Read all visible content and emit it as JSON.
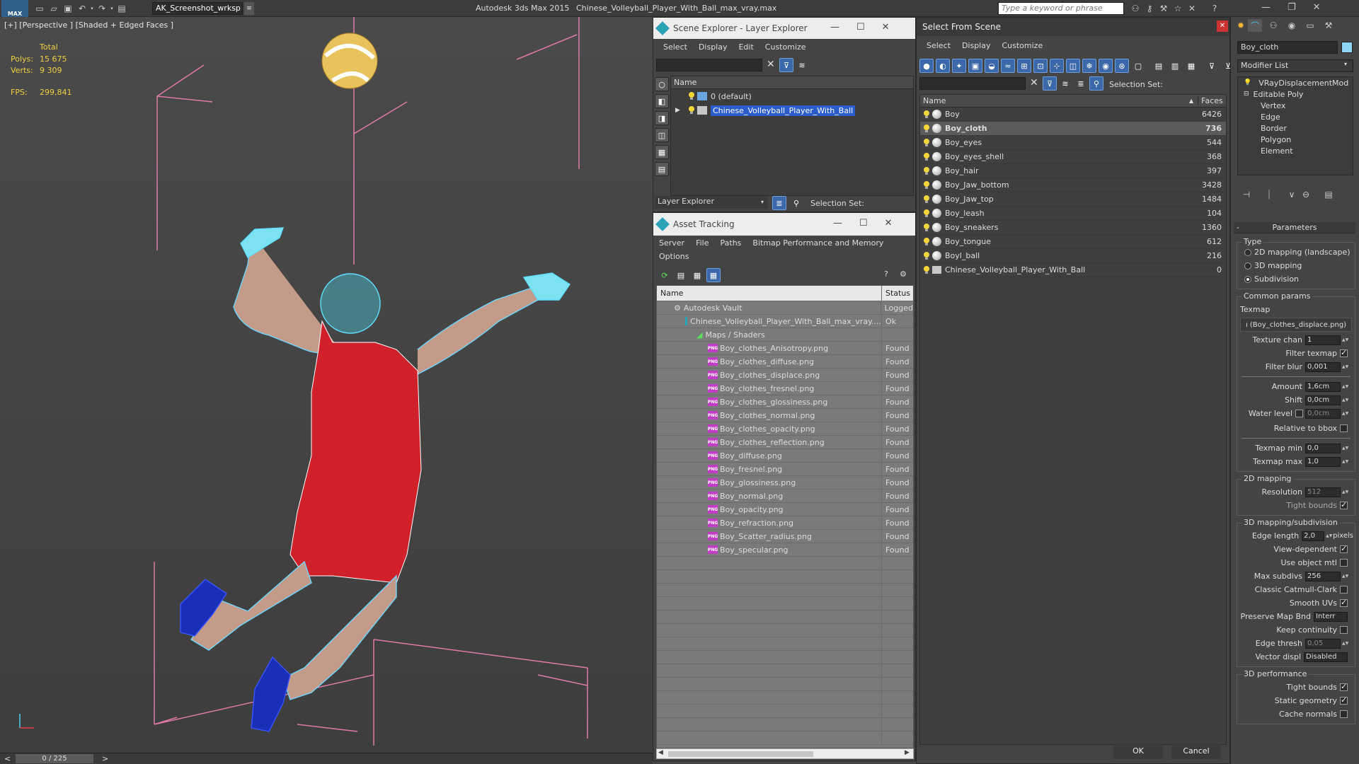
{
  "titlebar": {
    "logo": "MAX",
    "workspace": "AK_Screenshot_wrksp",
    "app": "Autodesk 3ds Max  2015",
    "file": "Chinese_Volleyball_Player_With_Ball_max_vray.max",
    "search_placeholder": "Type a keyword or phrase"
  },
  "viewport": {
    "label": "[+] [Perspective ] [Shaded + Edged Faces ]",
    "stats_header": "Total",
    "polys_label": "Polys:",
    "polys": "15 675",
    "verts_label": "Verts:",
    "verts": "9 309",
    "fps_label": "FPS:",
    "fps": "299,841"
  },
  "timeline": {
    "frame": "0 / 225",
    "prev": "<",
    "next": ">"
  },
  "scene_explorer": {
    "title": "Scene Explorer - Layer Explorer",
    "menu": [
      "Select",
      "Display",
      "Edit",
      "Customize"
    ],
    "col_name": "Name",
    "layers": [
      "0 (default)",
      "Chinese_Volleyball_Player_With_Ball"
    ],
    "footer_mode": "Layer Explorer",
    "selection_set": "Selection Set:"
  },
  "asset_tracking": {
    "title": "Asset Tracking",
    "menu": [
      "Server",
      "File",
      "Paths",
      "Bitmap Performance and Memory"
    ],
    "menu2": "Options",
    "col_name": "Name",
    "col_status": "Status",
    "vault": {
      "name": "Autodesk Vault",
      "status": "Logged"
    },
    "file": {
      "name": "Chinese_Volleyball_Player_With_Ball_max_vray....",
      "status": "Ok"
    },
    "folder": "Maps / Shaders",
    "maps": [
      {
        "name": "Boy_clothes_Anisotropy.png",
        "status": "Found"
      },
      {
        "name": "Boy_clothes_diffuse.png",
        "status": "Found"
      },
      {
        "name": "Boy_clothes_displace.png",
        "status": "Found"
      },
      {
        "name": "Boy_clothes_fresnel.png",
        "status": "Found"
      },
      {
        "name": "Boy_clothes_glossiness.png",
        "status": "Found"
      },
      {
        "name": "Boy_clothes_normal.png",
        "status": "Found"
      },
      {
        "name": "Boy_clothes_opacity.png",
        "status": "Found"
      },
      {
        "name": "Boy_clothes_reflection.png",
        "status": "Found"
      },
      {
        "name": "Boy_diffuse.png",
        "status": "Found"
      },
      {
        "name": "Boy_fresnel.png",
        "status": "Found"
      },
      {
        "name": "Boy_glossiness.png",
        "status": "Found"
      },
      {
        "name": "Boy_normal.png",
        "status": "Found"
      },
      {
        "name": "Boy_opacity.png",
        "status": "Found"
      },
      {
        "name": "Boy_refraction.png",
        "status": "Found"
      },
      {
        "name": "Boy_Scatter_radius.png",
        "status": "Found"
      },
      {
        "name": "Boy_specular.png",
        "status": "Found"
      }
    ],
    "png_tag": "PNG"
  },
  "select_from_scene": {
    "title": "Select From Scene",
    "menu": [
      "Select",
      "Display",
      "Customize"
    ],
    "selection_set": "Selection Set:",
    "col_name": "Name",
    "col_faces": "Faces",
    "objects": [
      {
        "name": "Boy",
        "faces": "6426"
      },
      {
        "name": "Boy_cloth",
        "faces": "736"
      },
      {
        "name": "Boy_eyes",
        "faces": "544"
      },
      {
        "name": "Boy_eyes_shell",
        "faces": "368"
      },
      {
        "name": "Boy_hair",
        "faces": "397"
      },
      {
        "name": "Boy_Jaw_bottom",
        "faces": "3428"
      },
      {
        "name": "Boy_Jaw_top",
        "faces": "1484"
      },
      {
        "name": "Boy_leash",
        "faces": "104"
      },
      {
        "name": "Boy_sneakers",
        "faces": "1360"
      },
      {
        "name": "Boy_tongue",
        "faces": "612"
      },
      {
        "name": "Boyl_ball",
        "faces": "216"
      },
      {
        "name": "Chinese_Volleyball_Player_With_Ball",
        "faces": "0"
      }
    ],
    "ok": "OK",
    "cancel": "Cancel"
  },
  "command_panel": {
    "object_name": "Boy_cloth",
    "modifier_list": "Modifier List",
    "stack": [
      "VRayDisplacementMod",
      "Editable Poly",
      "Vertex",
      "Edge",
      "Border",
      "Polygon",
      "Element"
    ],
    "parameters": "Parameters",
    "type_label": "Type",
    "type_options": [
      "2D mapping (landscape)",
      "3D mapping",
      "Subdivision"
    ],
    "common_params": "Common params",
    "texmap_label": "Texmap",
    "texmap_value": "ı (Boy_clothes_displace.png)",
    "texture_chan_label": "Texture chan",
    "texture_chan": "1",
    "filter_texmap": "Filter texmap",
    "filter_blur_label": "Filter blur",
    "filter_blur": "0,001",
    "amount_label": "Amount",
    "amount": "1,6cm",
    "shift_label": "Shift",
    "shift": "0,0cm",
    "water_level_label": "Water level",
    "water_level": "0,0cm",
    "relative_bbox": "Relative to bbox",
    "texmap_min_label": "Texmap min",
    "texmap_min": "0,0",
    "texmap_max_label": "Texmap max",
    "texmap_max": "1,0",
    "mapping2d": "2D mapping",
    "resolution_label": "Resolution",
    "resolution": "512",
    "tight_bounds": "Tight bounds",
    "mapping3d": "3D mapping/subdivision",
    "edge_length_label": "Edge length",
    "edge_length": "2,0",
    "pixels": "pixels",
    "view_dependent": "View-dependent",
    "use_object_mtl": "Use object mtl",
    "max_subdivs_label": "Max subdivs",
    "max_subdivs": "256",
    "classic_catmull": "Classic Catmull-Clark",
    "smooth_uvs": "Smooth UVs",
    "preserve_map_label": "Preserve Map Bnd",
    "preserve_map": "Interr",
    "keep_continuity": "Keep continuity",
    "edge_thresh_label": "Edge thresh",
    "edge_thresh": "0,05",
    "vector_disp_label": "Vector displ",
    "vector_disp": "Disabled",
    "perf3d": "3D performance",
    "tight_bounds2": "Tight bounds",
    "static_geometry": "Static geometry",
    "cache_normals": "Cache normals"
  },
  "colors": {
    "highlight": "#2a5dc9",
    "selected_row": "#5b5b5b",
    "viewport_bg": "#444444",
    "panel_bg": "#444444"
  }
}
